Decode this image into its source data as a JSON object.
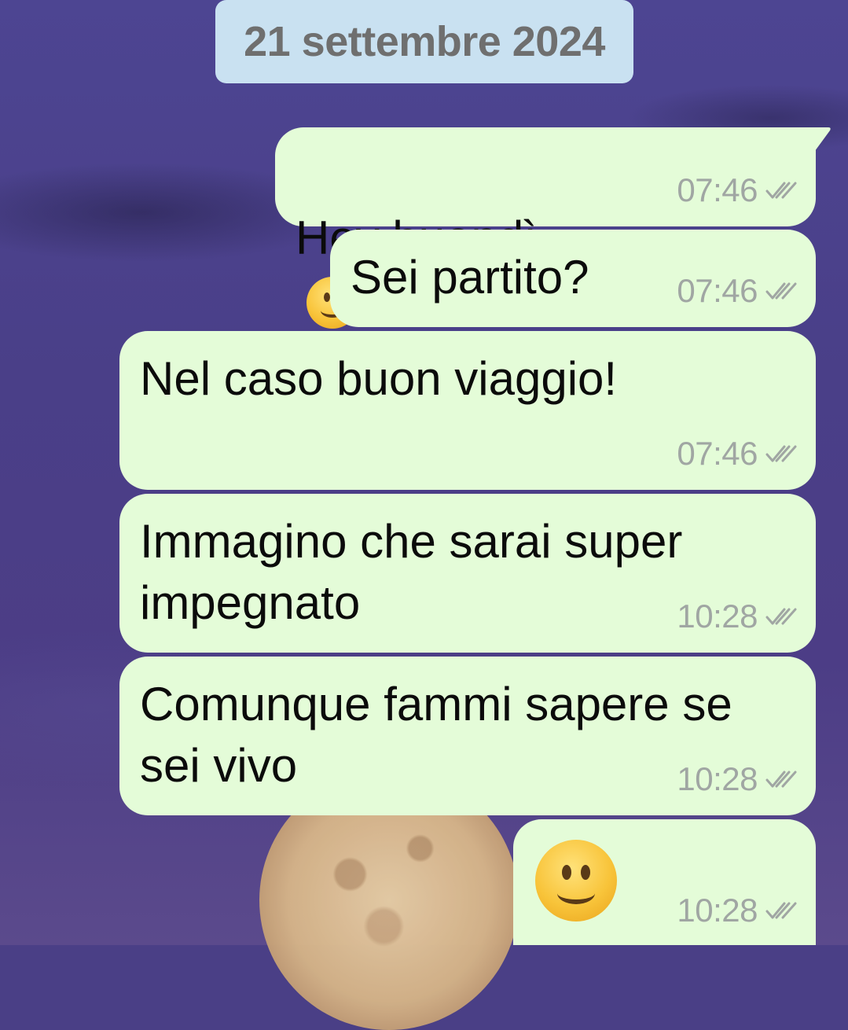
{
  "chat": {
    "date_separator": "21 settembre 2024",
    "messages": [
      {
        "text": "Hey buondì",
        "emoji": "slightly-smiling-face",
        "time": "07:46",
        "status": "delivered-double-tick"
      },
      {
        "text": "Sei partito?",
        "time": "07:46",
        "status": "delivered-double-tick"
      },
      {
        "text": "Nel caso buon viaggio!",
        "time": "07:46",
        "status": "delivered-double-tick"
      },
      {
        "text": "Immagino che sarai super\nimpegnato",
        "time": "10:28",
        "status": "delivered-double-tick"
      },
      {
        "text": "Comunque fammi sapere se\nsei vivo",
        "time": "10:28",
        "status": "delivered-double-tick"
      },
      {
        "text": "",
        "emoji": "slightly-smiling-face",
        "time": "10:28",
        "status": "delivered-double-tick"
      }
    ]
  },
  "colors": {
    "bubble_outgoing": "#e4fcd8",
    "date_pill": "#c9e1f1",
    "timestamp": "#a0a6a3",
    "wallpaper": "#4a3f86"
  }
}
